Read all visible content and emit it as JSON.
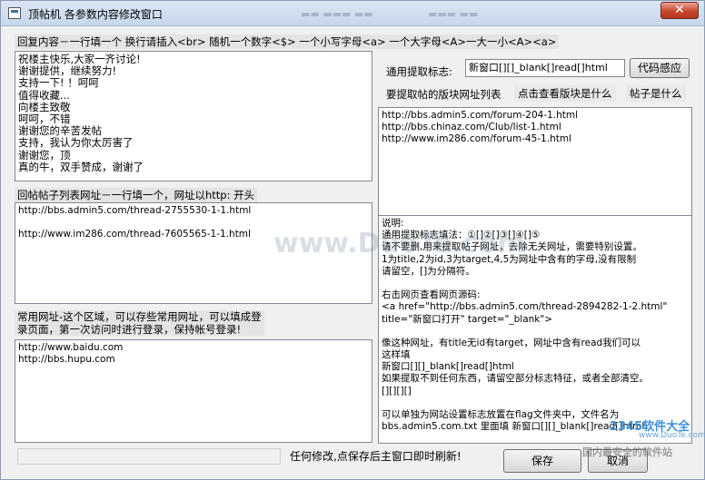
{
  "window": {
    "title": "顶帖机 各参数内容修改窗口",
    "close_glyph": "✕"
  },
  "reply": {
    "label": "回复内容－一行填一个   换行请插入<br> 随机一个数字<$> 一个小写字母<a> 一个大字母<A>一大一小<A><a>",
    "lines": [
      "祝楼主快乐,大家一齐讨论!",
      "谢谢提供，继续努力!",
      "支持一下! ！呵呵",
      "值得收藏...",
      "向楼主致敬",
      "呵呵，不错",
      "谢谢您的辛苦发帖",
      "支持，我认为你太厉害了",
      "谢谢您，顶",
      "真的牛，双手赞成，谢谢了"
    ]
  },
  "thread_urls": {
    "label": "回帖帖子列表网址－一行填一个，网址以http:  开头",
    "lines": [
      "http://bbs.admin5.com/thread-2755530-1-1.html",
      "",
      "http://www.im286.com/thread-7605565-1-1.html"
    ]
  },
  "common_urls": {
    "label_line1": "常用网址-这个区域，可以存些常用网址，可以填成登",
    "label_line2": "录页面，第一次访问时进行登录，保持帐号登录!",
    "lines": [
      "http://www.baidu.com",
      "http://bbs.hupu.com"
    ]
  },
  "extract": {
    "label": "通用提取标志:",
    "value": "新窗口[][]_blank[]read[]html",
    "sense_button": "代码感应"
  },
  "forum_list": {
    "label": "要提取帖的版块网址列表",
    "view_link": "点击查看版块是什么",
    "what_link": "帖子是什么",
    "lines": [
      "http://bbs.admin5.com/forum-204-1.html",
      "http://bbs.chinaz.com/Club/list-1.html",
      "http://www.im286.com/forum-45-1.html"
    ]
  },
  "notes": {
    "lines": [
      "说明:",
      "通用提取标志填法：①[]②[]③[]④[]⑤",
      "请不要删,用来提取帖子网址，去除无关网址，需要特别设置。",
      "1为title,2为id,3为target,4,5为网址中含有的字母,没有限制",
      "请留空，[]为分隔符。",
      "",
      "右击网页查看网页源码:",
      "<a href=\"http://bbs.admin5.com/thread-2894282-1-2.html\"",
      "title=\"新窗口打开\" target=\"_blank\">",
      "",
      "像这种网址，有title无id有target，网址中含有read我们可以",
      "这样填",
      "新窗口[][]_blank[]read[]html",
      "如果提取不到任何东西，请留空部分标志特征，或者全部清空。",
      "[][][][]",
      "",
      "可以单独为网站设置标志放置在flag文件夹中，文件名为",
      "bbs.admin5.com.txt 里面填    新窗口[][]_blank[]read[]html"
    ]
  },
  "footer": {
    "status_text": "任何修改,点保存后主窗口即时刷新!",
    "save_button": "保存",
    "cancel_button": "取消"
  },
  "watermarks": {
    "center": "www.DuoTe.com",
    "corner_brand": "2345软件大全",
    "corner_url": "www.DuoTe.com",
    "corner_tagline": "国内最安全的软件站"
  }
}
